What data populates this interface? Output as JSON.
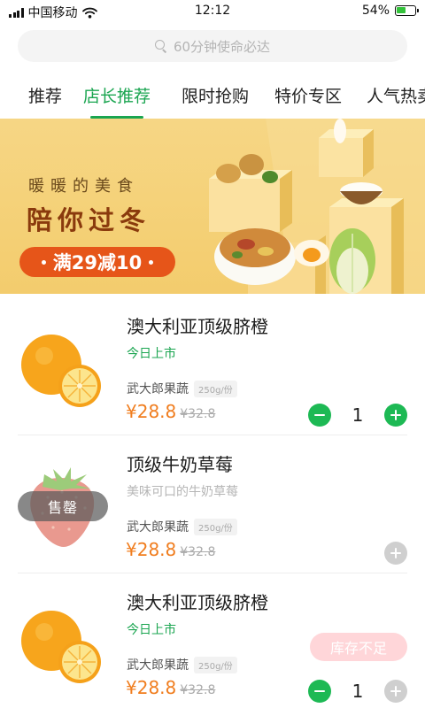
{
  "status_bar": {
    "carrier": "中国移动",
    "time": "12:12",
    "battery": "54%",
    "battery_level": 0.54,
    "icons": [
      "signal-icon",
      "wifi-icon",
      "battery-icon"
    ]
  },
  "search": {
    "placeholder": "60分钟使命必达"
  },
  "tabs": [
    {
      "label": "推荐",
      "active": false
    },
    {
      "label": "店长推荐",
      "active": true
    },
    {
      "label": "限时抢购",
      "active": false
    },
    {
      "label": "特价专区",
      "active": false
    },
    {
      "label": "人气热卖",
      "active": false
    }
  ],
  "banner": {
    "line1": "暖暖的美食",
    "line2": "陪你过冬",
    "promo": "满29减10"
  },
  "products": [
    {
      "name": "澳大利亚顶级脐橙",
      "subtitle": "今日上市",
      "shop": "武大郎果蔬",
      "unit": "250g/份",
      "price": "¥28.8",
      "old_price": "¥32.8",
      "quantity": "1",
      "image_icon": "orange-icon"
    },
    {
      "name": "顶级牛奶草莓",
      "subtitle": "美味可口的牛奶草莓",
      "shop": "武大郎果蔬",
      "unit": "250g/份",
      "price": "¥28.8",
      "old_price": "¥32.8",
      "sold_out": "售罄",
      "image_icon": "strawberry-icon"
    },
    {
      "name": "澳大利亚顶级脐橙",
      "subtitle": "今日上市",
      "shop": "武大郎果蔬",
      "unit": "250g/份",
      "price": "¥28.8",
      "old_price": "¥32.8",
      "quantity": "1",
      "stock_notice": "库存不足",
      "image_icon": "orange-icon"
    }
  ],
  "colors": {
    "accent_green": "#1aa550",
    "price_orange": "#f07d1e",
    "banner_bg": "#f5d27a",
    "promo_red": "#e65519"
  }
}
